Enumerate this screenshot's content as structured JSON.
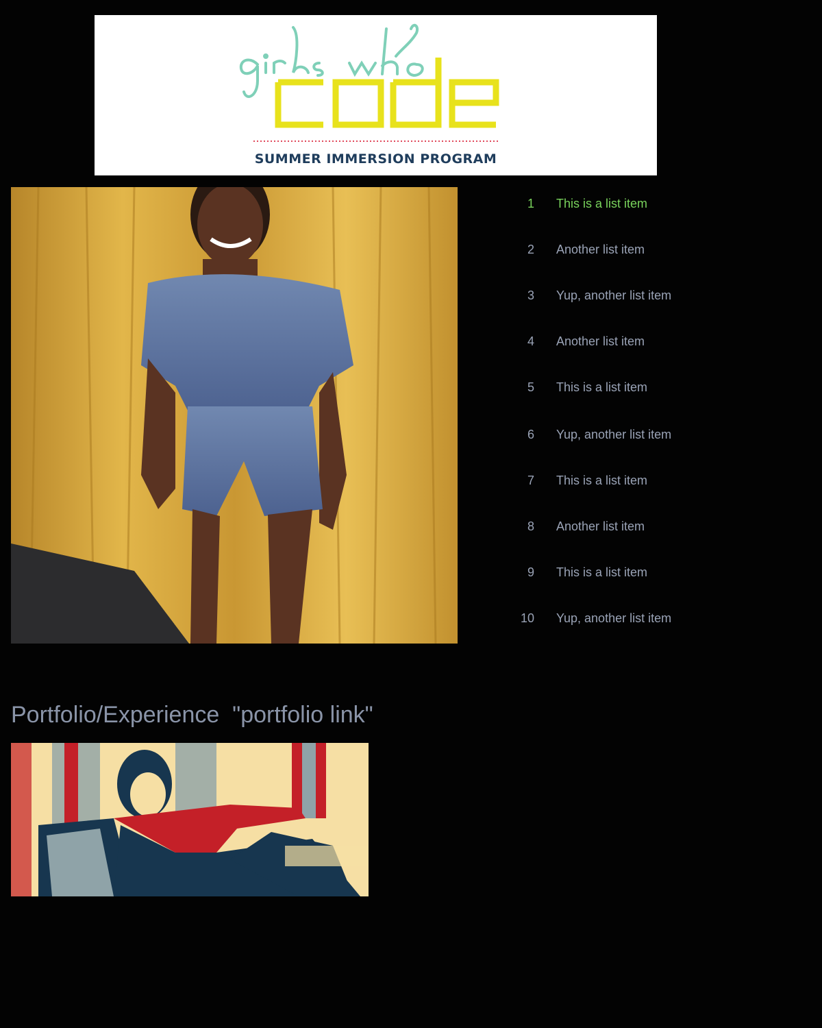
{
  "colors": {
    "page_background": "#030303",
    "list_text": "#9aa3b6",
    "list_active_text": "#79d35c",
    "heading_text": "#8a94a8",
    "banner_teal": "#7fd0b8",
    "banner_yellow": "#e8e21c",
    "banner_navy": "#1f3d5c",
    "banner_dots": "#e0475a"
  },
  "banner": {
    "tagline": "SUMMER IMMERSION PROGRAM",
    "logo_icon": "girls-who-code-logo"
  },
  "profile_photo": {
    "icon": "profile-photo"
  },
  "list": {
    "items": [
      {
        "number": "1",
        "text": "This is a list item",
        "active": true
      },
      {
        "number": "2",
        "text": "Another list item",
        "active": false
      },
      {
        "number": "3",
        "text": "Yup, another list item",
        "active": false
      },
      {
        "number": "4",
        "text": "Another list item",
        "active": false
      },
      {
        "number": "5",
        "text": "This is a list item",
        "active": false
      },
      {
        "number": "6",
        "text": "Yup, another list item",
        "active": false
      },
      {
        "number": "7",
        "text": "This is a list item",
        "active": false
      },
      {
        "number": "8",
        "text": "Another list item",
        "active": false
      },
      {
        "number": "9",
        "text": "This is a list item",
        "active": false
      },
      {
        "number": "10",
        "text": "Yup, another list item",
        "active": false
      }
    ]
  },
  "portfolio": {
    "heading": "Portfolio/Experience  \"portfolio link\"",
    "poster_icon": "poster-art"
  }
}
